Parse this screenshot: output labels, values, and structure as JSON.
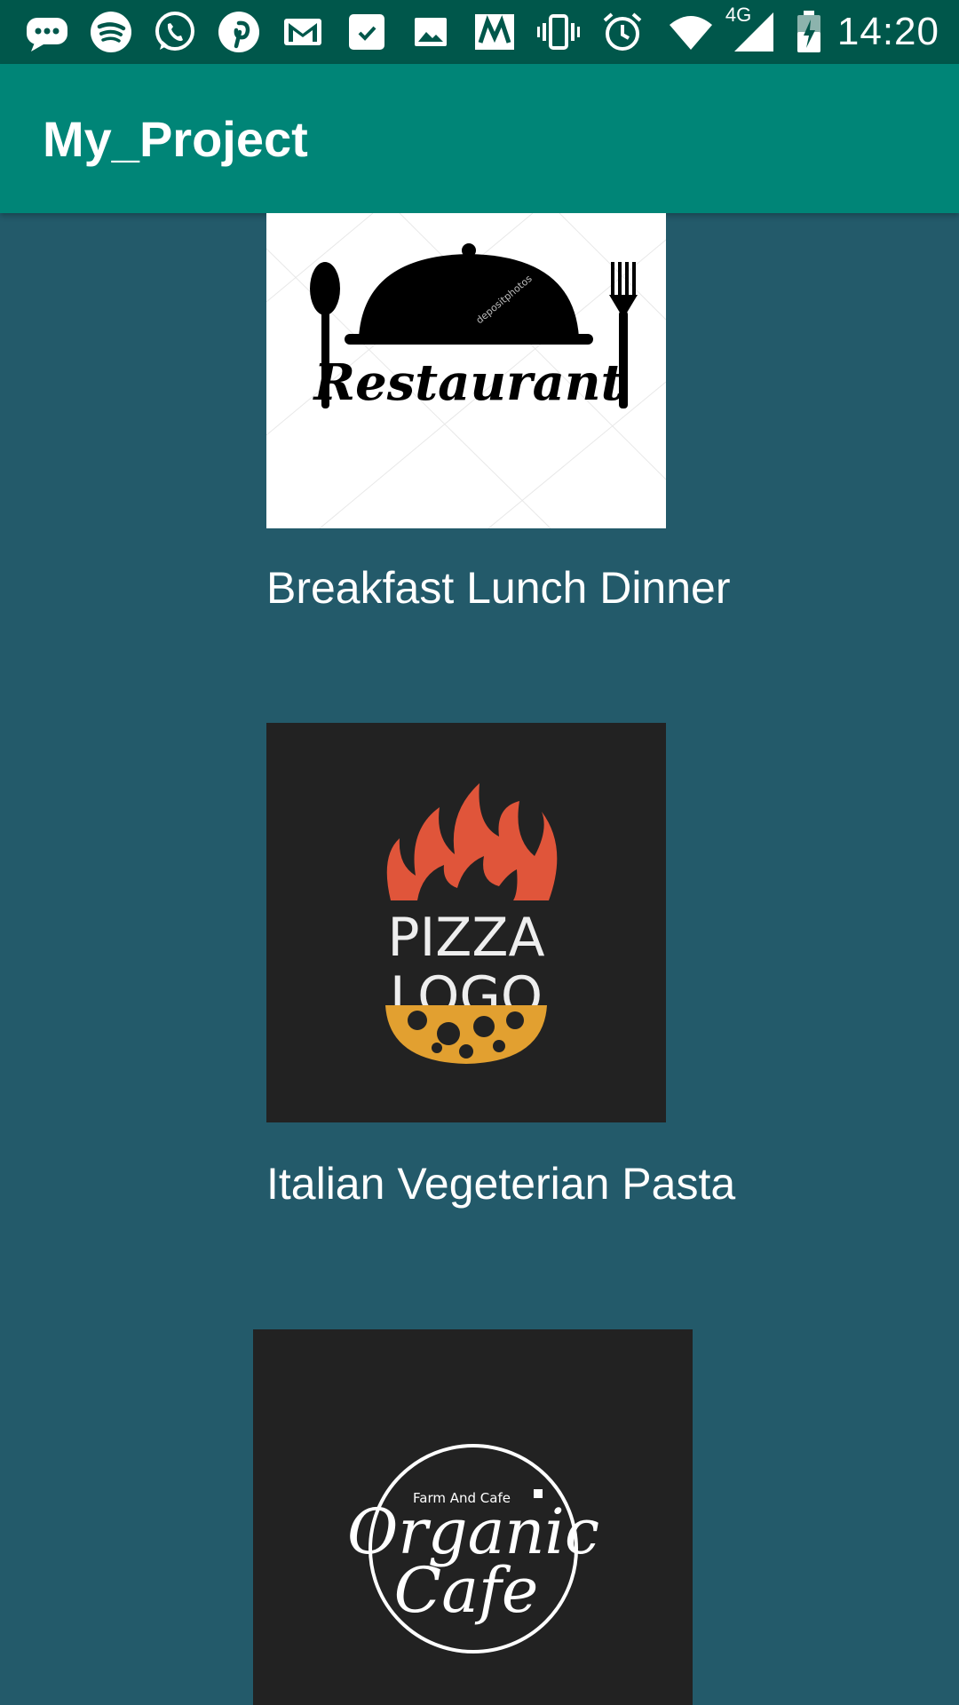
{
  "status_bar": {
    "time": "14:20",
    "network_label": "4G",
    "icons": [
      "messages-icon",
      "spotify-icon",
      "whatsapp-icon",
      "pinterest-icon",
      "gmail-icon",
      "tasks-icon",
      "gallery-icon",
      "app-icon",
      "vibrate-icon",
      "alarm-icon",
      "wifi-icon",
      "signal-icon",
      "battery-charging-icon"
    ]
  },
  "app_bar": {
    "title": "My_Project"
  },
  "items": [
    {
      "label": "Breakfast Lunch Dinner",
      "image_icon": "restaurant-logo-icon",
      "logo_text": "Restaurant"
    },
    {
      "label": "Italian Vegeterian Pasta",
      "image_icon": "pizza-logo-icon",
      "logo_text": [
        "PIZZA",
        "LOGO"
      ]
    },
    {
      "label": "",
      "image_icon": "organic-cafe-logo-icon",
      "logo_text": [
        "Farm And Cafe",
        "Organic",
        "Cafe"
      ]
    }
  ],
  "colors": {
    "status_bar": "#00574b",
    "app_bar": "#008577",
    "background": "#235a6a",
    "text": "#ffffff"
  }
}
